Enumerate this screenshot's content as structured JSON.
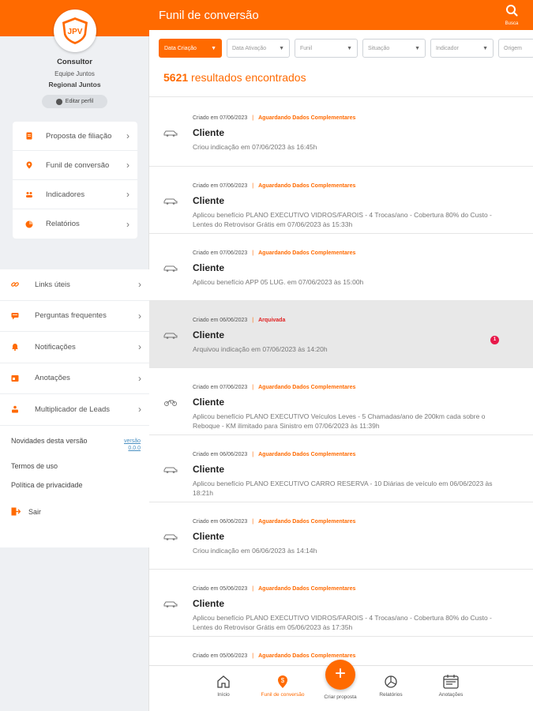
{
  "brand": {
    "accent": "#ff6a00",
    "logo_text": "JPV"
  },
  "sidebar": {
    "role": "Consultor",
    "team": "Equipe Juntos",
    "region": "Regional Juntos",
    "edit_profile": "Editar perfil",
    "card_items": [
      {
        "label": "Proposta de filiação",
        "icon": "document-icon"
      },
      {
        "label": "Funil de conversão",
        "icon": "funnel-pin-icon"
      },
      {
        "label": "Indicadores",
        "icon": "people-icon"
      },
      {
        "label": "Relatórios",
        "icon": "pie-chart-icon"
      }
    ],
    "list_items": [
      {
        "label": "Links úteis",
        "icon": "link-icon"
      },
      {
        "label": "Perguntas frequentes",
        "icon": "chat-icon"
      },
      {
        "label": "Notificações",
        "icon": "bell-icon"
      },
      {
        "label": "Anotações",
        "icon": "notes-icon"
      },
      {
        "label": "Multiplicador de Leads",
        "icon": "multiplier-icon"
      }
    ],
    "news": "Novidades desta versão",
    "version": "versão 0.0.0",
    "terms": "Termos de uso",
    "privacy": "Política de privacidade",
    "logout": "Sair"
  },
  "header": {
    "title": "Funil de conversão",
    "search_label": "Busca"
  },
  "filters": [
    {
      "label": "Data Criação",
      "active": true
    },
    {
      "label": "Data Ativação",
      "active": false
    },
    {
      "label": "Funil",
      "active": false
    },
    {
      "label": "Situação",
      "active": false
    },
    {
      "label": "Indicador",
      "active": false
    },
    {
      "label": "Origem",
      "active": false
    }
  ],
  "results": {
    "count": "5621",
    "label": "resultados encontrados"
  },
  "leads": [
    {
      "created": "Criado em 07/06/2023",
      "status": "Aguardando Dados Complementares",
      "name": "Cliente",
      "desc": "Criou indicação em 07/06/2023 às 16:45h",
      "vehicle": "car"
    },
    {
      "created": "Criado em 07/06/2023",
      "status": "Aguardando Dados Complementares",
      "name": "Cliente",
      "desc": "Aplicou benefício PLANO EXECUTIVO VIDROS/FAROIS - 4 Trocas/ano - Cobertura 80% do Custo - Lentes do Retrovisor Grátis em 07/06/2023 às 15:33h",
      "vehicle": "car"
    },
    {
      "created": "Criado em 07/06/2023",
      "status": "Aguardando Dados Complementares",
      "name": "Cliente",
      "desc": "Aplicou benefício APP 05 LUG. em 07/06/2023 às 15:00h",
      "vehicle": "car"
    },
    {
      "created": "Criado em 06/06/2023",
      "status": "Arquivada",
      "name": "Cliente",
      "desc": "Arquivou indicação em 07/06/2023 às 14:20h",
      "vehicle": "car",
      "archived": true,
      "badge": "1"
    },
    {
      "created": "Criado em 07/06/2023",
      "status": "Aguardando Dados Complementares",
      "name": "Cliente",
      "desc": "Aplicou benefício PLANO EXECUTIVO Veículos Leves - 5 Chamadas/ano de 200km cada sobre o Reboque - KM ilimitado para Sinistro em 07/06/2023 às 11:39h",
      "vehicle": "motorcycle"
    },
    {
      "created": "Criado em 06/06/2023",
      "status": "Aguardando Dados Complementares",
      "name": "Cliente",
      "desc": "Aplicou benefício PLANO EXECUTIVO CARRO RESERVA - 10 Diárias de veículo em 06/06/2023 às 18:21h",
      "vehicle": "car"
    },
    {
      "created": "Criado em 06/06/2023",
      "status": "Aguardando Dados Complementares",
      "name": "Cliente",
      "desc": "Criou indicação em 06/06/2023 às 14:14h",
      "vehicle": "car"
    },
    {
      "created": "Criado em 05/06/2023",
      "status": "Aguardando Dados Complementares",
      "name": "Cliente",
      "desc": "Aplicou benefício PLANO EXECUTIVO VIDROS/FAROIS - 4 Trocas/ano - Cobertura 80% do Custo - Lentes do Retrovisor Grátis em 05/06/2023 às 17:35h",
      "vehicle": "car"
    },
    {
      "created": "Criado em 05/06/2023",
      "status": "Aguardando Dados Complementares",
      "name": "",
      "desc": "",
      "vehicle": "car"
    }
  ],
  "bottom_nav": {
    "home": "Início",
    "funnel": "Funil de conversão",
    "create": "Criar proposta",
    "reports": "Relatórios",
    "notes": "Anotações"
  }
}
